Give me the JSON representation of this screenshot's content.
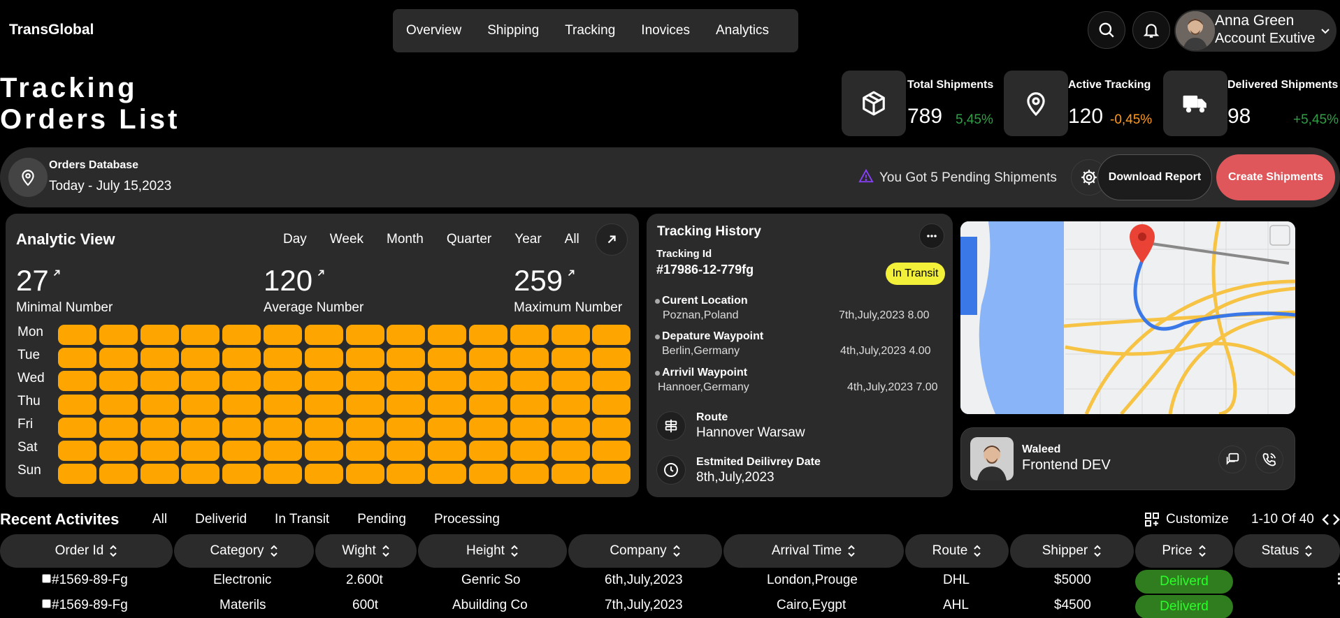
{
  "brand": "TransGlobal",
  "nav": {
    "items": [
      "Overview",
      "Shipping",
      "Tracking",
      "Inovices",
      "Analytics"
    ]
  },
  "user": {
    "name": "Anna Green",
    "role": "Account Exutive"
  },
  "page_title": {
    "line1": "Tracking",
    "line2": "Orders List"
  },
  "stats": [
    {
      "label": "Total Shipments",
      "value": "789",
      "change": "5,45%",
      "change_color": "#2ea043",
      "icon": "box-icon"
    },
    {
      "label": "Active Tracking",
      "value": "120",
      "change": "-0,45%",
      "change_color": "#ff9a1f",
      "icon": "location-pin-icon"
    },
    {
      "label": "Delivered Shipments",
      "value": "98",
      "change": "+5,45%",
      "change_color": "#2ea043",
      "icon": "truck-icon"
    }
  ],
  "orders_bar": {
    "title": "Orders Database",
    "date": "Today - July 15,2023",
    "pending": "You Got 5 Pending Shipments",
    "download": "Download Report",
    "create": "Create Shipments"
  },
  "analytic": {
    "title": "Analytic View",
    "periods": [
      "Day",
      "Week",
      "Month",
      "Quarter",
      "Year",
      "All"
    ],
    "metrics": [
      {
        "value": "27",
        "label": "Minimal Number"
      },
      {
        "value": "120",
        "label": "Average Number"
      },
      {
        "value": "259",
        "label": "Maximum Number"
      }
    ],
    "days": [
      "Mon",
      "Tue",
      "Wed",
      "Thu",
      "Fri",
      "Sat",
      "Sun"
    ],
    "cell_color": "#ffa500"
  },
  "tracking": {
    "title": "Tracking History",
    "id_label": "Tracking Id",
    "id_value": "#17986-12-779fg",
    "status": "In Transit",
    "points": [
      {
        "label": "Curent Location",
        "place": "Poznan,Poland",
        "time": "7th,July,2023 8.00"
      },
      {
        "label": "Depature Waypoint",
        "place": "Berlin,Germany",
        "time": "4th,July,2023 4.00"
      },
      {
        "label": "Arrivil Waypoint",
        "place": "Hannoer,Germany",
        "time": "4th,July,2023 7.00"
      }
    ],
    "route_label": "Route",
    "route_value": "Hannover Warsaw",
    "eta_label": "Estmited Deilivrey Date",
    "eta_value": "8th,July,2023"
  },
  "driver": {
    "name": "Waleed",
    "role": "Frontend DEV"
  },
  "recent": {
    "title": "Recent Activites",
    "filters": [
      "All",
      "Deliverid",
      "In Transit",
      "Pending",
      "Processing"
    ],
    "customize": "Customize",
    "pagination": "1-10 Of 40"
  },
  "table": {
    "headers": [
      "Order Id",
      "Category",
      "Wight",
      "Height",
      "Company",
      "Arrival Time",
      "Route",
      "Shipper",
      "Price",
      "Status"
    ],
    "rows": [
      [
        "#1569-89-Fg",
        "Electronic",
        "2.600t",
        "Genric So",
        "6th,July,2023",
        "London,Prouge",
        "DHL",
        "$5000",
        "Deliverd"
      ],
      [
        "#1569-89-Fg",
        "Materils",
        "600t",
        "Abuilding Co",
        "7th,July,2023",
        "Cairo,Eygpt",
        "AHL",
        "$4500",
        "Deliverd"
      ]
    ]
  },
  "colors": {
    "accent": "#e0575b",
    "status_green": "#2f7d1e",
    "status_text": "#29ff29",
    "badge_yellow": "#f3f03a",
    "warning_purple": "#8a3ffc"
  }
}
